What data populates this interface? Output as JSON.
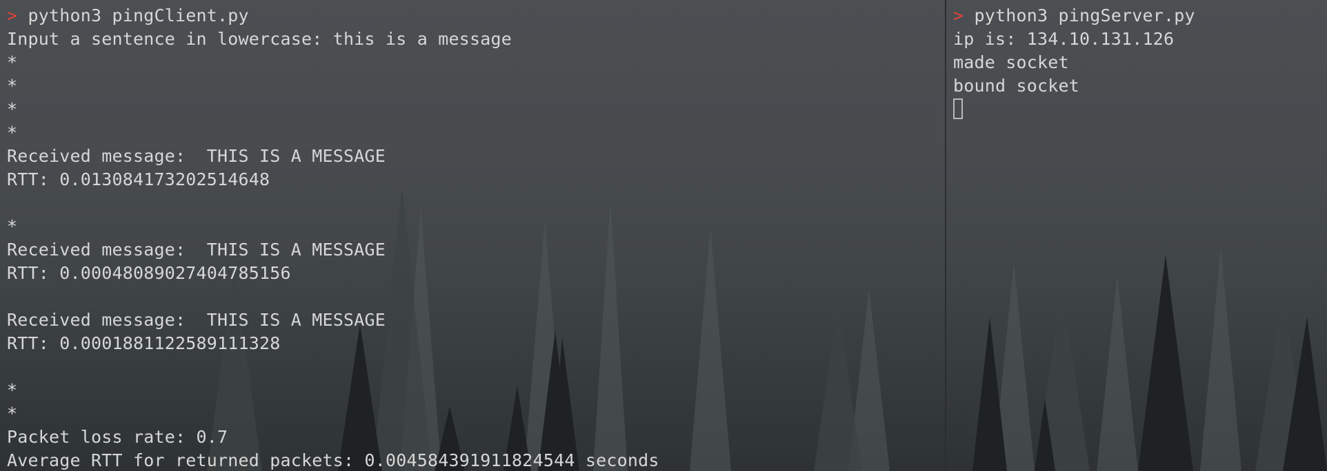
{
  "colors": {
    "prompt": "#e0433a",
    "text": "#d6d7d6",
    "background": "#4a4e51"
  },
  "left_pane": {
    "prompt_symbol": ">",
    "command": "python3 pingClient.py",
    "lines": [
      "Input a sentence in lowercase: this is a message",
      "*",
      "*",
      "*",
      "*",
      "Received message:  THIS IS A MESSAGE",
      "RTT: 0.013084173202514648",
      "",
      "*",
      "Received message:  THIS IS A MESSAGE",
      "RTT: 0.00048089027404785156",
      "",
      "Received message:  THIS IS A MESSAGE",
      "RTT: 0.0001881122589111328",
      "",
      "*",
      "*",
      "Packet loss rate: 0.7",
      "Average RTT for returned packets: 0.004584391911824544 seconds"
    ]
  },
  "right_pane": {
    "prompt_symbol": ">",
    "command": "python3 pingServer.py",
    "lines": [
      "ip is: 134.10.131.126",
      "made socket",
      "bound socket"
    ]
  }
}
